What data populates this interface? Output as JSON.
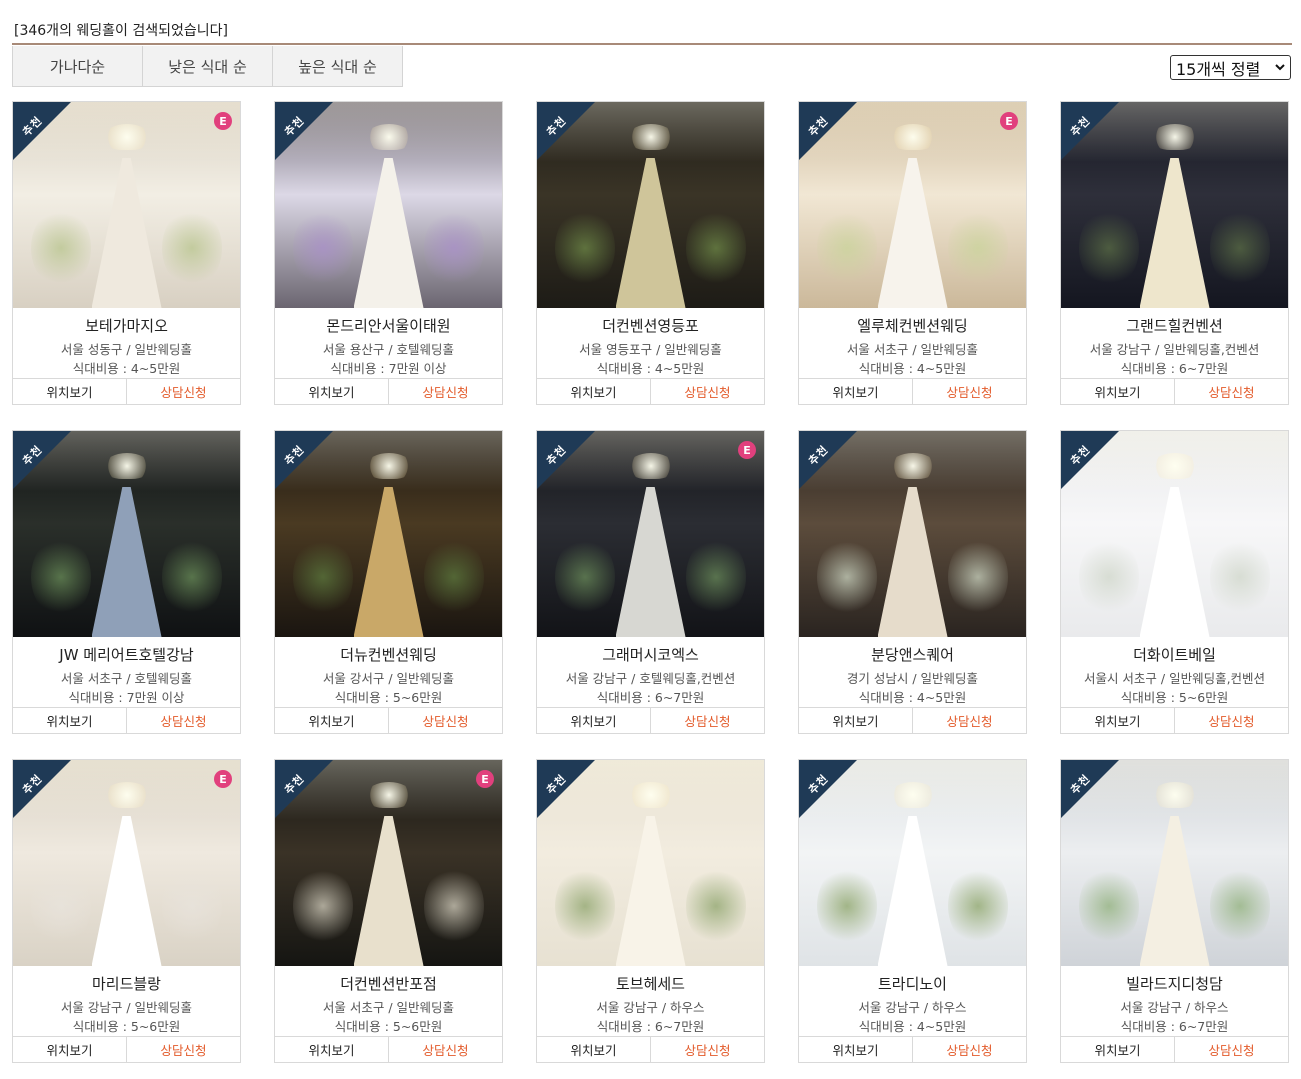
{
  "search": {
    "result_text": "[346개의 웨딩홀이 검색되었습니다]"
  },
  "sort": {
    "tabs": [
      "가나다순",
      "낮은 식대 순",
      "높은 식대 순"
    ],
    "select_label": "15개씩 정렬"
  },
  "badges": {
    "recommend": "추천",
    "event": "E"
  },
  "actions": {
    "map": "위치보기",
    "consult": "상담신청"
  },
  "venues": [
    {
      "name": "보테가마지오",
      "location": "서울 성동구 / 일반웨딩홀",
      "cost": "식대비용 : 4~5만원",
      "event": true
    },
    {
      "name": "몬드리안서울이태원",
      "location": "서울 용산구 / 호텔웨딩홀",
      "cost": "식대비용 : 7만원 이상",
      "event": false
    },
    {
      "name": "더컨벤션영등포",
      "location": "서울 영등포구 / 일반웨딩홀",
      "cost": "식대비용 : 4~5만원",
      "event": false
    },
    {
      "name": "엘루체컨벤션웨딩",
      "location": "서울 서초구 / 일반웨딩홀",
      "cost": "식대비용 : 4~5만원",
      "event": true
    },
    {
      "name": "그랜드힐컨벤션",
      "location": "서울 강남구 / 일반웨딩홀,컨벤션",
      "cost": "식대비용 : 6~7만원",
      "event": false
    },
    {
      "name": "JW 메리어트호텔강남",
      "location": "서울 서초구 / 호텔웨딩홀",
      "cost": "식대비용 : 7만원 이상",
      "event": false
    },
    {
      "name": "더뉴컨벤션웨딩",
      "location": "서울 강서구 / 일반웨딩홀",
      "cost": "식대비용 : 5~6만원",
      "event": false
    },
    {
      "name": "그래머시코엑스",
      "location": "서울 강남구 / 호텔웨딩홀,컨벤션",
      "cost": "식대비용 : 6~7만원",
      "event": true
    },
    {
      "name": "분당앤스퀘어",
      "location": "경기 성남시 / 일반웨딩홀",
      "cost": "식대비용 : 4~5만원",
      "event": false
    },
    {
      "name": "더화이트베일",
      "location": "서울시 서초구 / 일반웨딩홀,컨벤션",
      "cost": "식대비용 : 5~6만원",
      "event": false
    },
    {
      "name": "마리드블랑",
      "location": "서울 강남구 / 일반웨딩홀",
      "cost": "식대비용 : 5~6만원",
      "event": true
    },
    {
      "name": "더컨벤션반포점",
      "location": "서울 서초구 / 일반웨딩홀",
      "cost": "식대비용 : 5~6만원",
      "event": true
    },
    {
      "name": "토브헤세드",
      "location": "서울 강남구 / 하우스",
      "cost": "식대비용 : 6~7만원",
      "event": false
    },
    {
      "name": "트라디노이",
      "location": "서울 강남구 / 하우스",
      "cost": "식대비용 : 4~5만원",
      "event": false
    },
    {
      "name": "빌라드지디청담",
      "location": "서울 강남구 / 하우스",
      "cost": "식대비용 : 6~7만원",
      "event": false
    }
  ]
}
